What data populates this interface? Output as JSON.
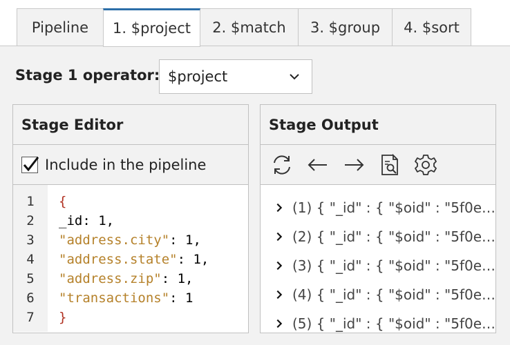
{
  "tabs": [
    {
      "label": "Pipeline",
      "active": false
    },
    {
      "label": "1. $project",
      "active": true
    },
    {
      "label": "2. $match",
      "active": false
    },
    {
      "label": "3. $group",
      "active": false
    },
    {
      "label": "4. $sort",
      "active": false
    }
  ],
  "operator": {
    "label": "Stage 1 operator:",
    "selected": "$project"
  },
  "editor": {
    "title": "Stage Editor",
    "include_label": "Include in the pipeline",
    "include_checked": true,
    "line_numbers": [
      "1",
      "2",
      "3",
      "4",
      "5",
      "6",
      "7"
    ],
    "lines": {
      "l1": "{",
      "l2_key": "_id",
      "l2_rest": ": 1,",
      "l3_key": "\"address.city\"",
      "l3_rest": ": 1,",
      "l4_key": "\"address.state\"",
      "l4_rest": ": 1,",
      "l5_key": "\"address.zip\"",
      "l5_rest": ": 1,",
      "l6_key": "\"transactions\"",
      "l6_rest": ": 1",
      "l7": "}"
    }
  },
  "output": {
    "title": "Stage Output",
    "toolbar_icons": [
      "refresh-icon",
      "arrow-left-icon",
      "arrow-right-icon",
      "document-search-icon",
      "gear-icon"
    ],
    "items": [
      "(1) { \"_id\" : { \"$oid\" : \"5f0e…",
      "(2) { \"_id\" : { \"$oid\" : \"5f0e…",
      "(3) { \"_id\" : { \"$oid\" : \"5f0e…",
      "(4) { \"_id\" : { \"$oid\" : \"5f0e…",
      "(5) { \"_id\" : { \"$oid\" : \"5f0e…"
    ]
  },
  "colors": {
    "accent": "#2c6ea8",
    "string": "#b5812a",
    "brace": "#b03020"
  }
}
